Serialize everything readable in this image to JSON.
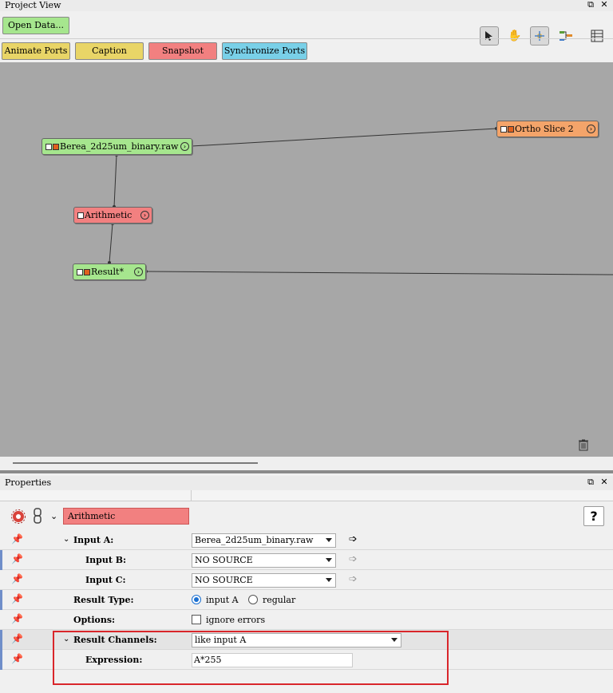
{
  "project_view": {
    "title": "Project View",
    "open_data_label": "Open Data...",
    "buttons": [
      "Animate Ports",
      "Caption",
      "Snapshot",
      "Synchronize Ports"
    ],
    "tools": [
      "select-pointer-icon",
      "hand-icon",
      "network-icon",
      "tree-icon",
      "layout-icon"
    ]
  },
  "graph": {
    "nodes": [
      {
        "label": "Berea_2d25um_binary.raw",
        "color": "#a6e68e"
      },
      {
        "label": "Ortho Slice 2",
        "color": "#f4a46a"
      },
      {
        "label": "Arithmetic",
        "color": "#f28080"
      },
      {
        "label": "Result*",
        "color": "#a6e68e"
      }
    ]
  },
  "properties": {
    "title": "Properties",
    "module_name": "Arithmetic",
    "help_label": "?",
    "rows": [
      {
        "label": "Input A:",
        "value": "Berea_2d25um_binary.raw"
      },
      {
        "label": "Input B:",
        "value": "NO SOURCE"
      },
      {
        "label": "Input C:",
        "value": "NO SOURCE"
      },
      {
        "label": "Result Type:",
        "option1": "input A",
        "option2": "regular",
        "selected": "input A"
      },
      {
        "label": "Options:",
        "checkbox": "ignore errors",
        "checked": false
      },
      {
        "label": "Result Channels:",
        "value": "like input A"
      },
      {
        "label": "Expression:",
        "value": "A*255"
      }
    ]
  },
  "colors": {
    "highlight_box": "#d9262b",
    "canvas_bg": "#a7a7a7"
  }
}
